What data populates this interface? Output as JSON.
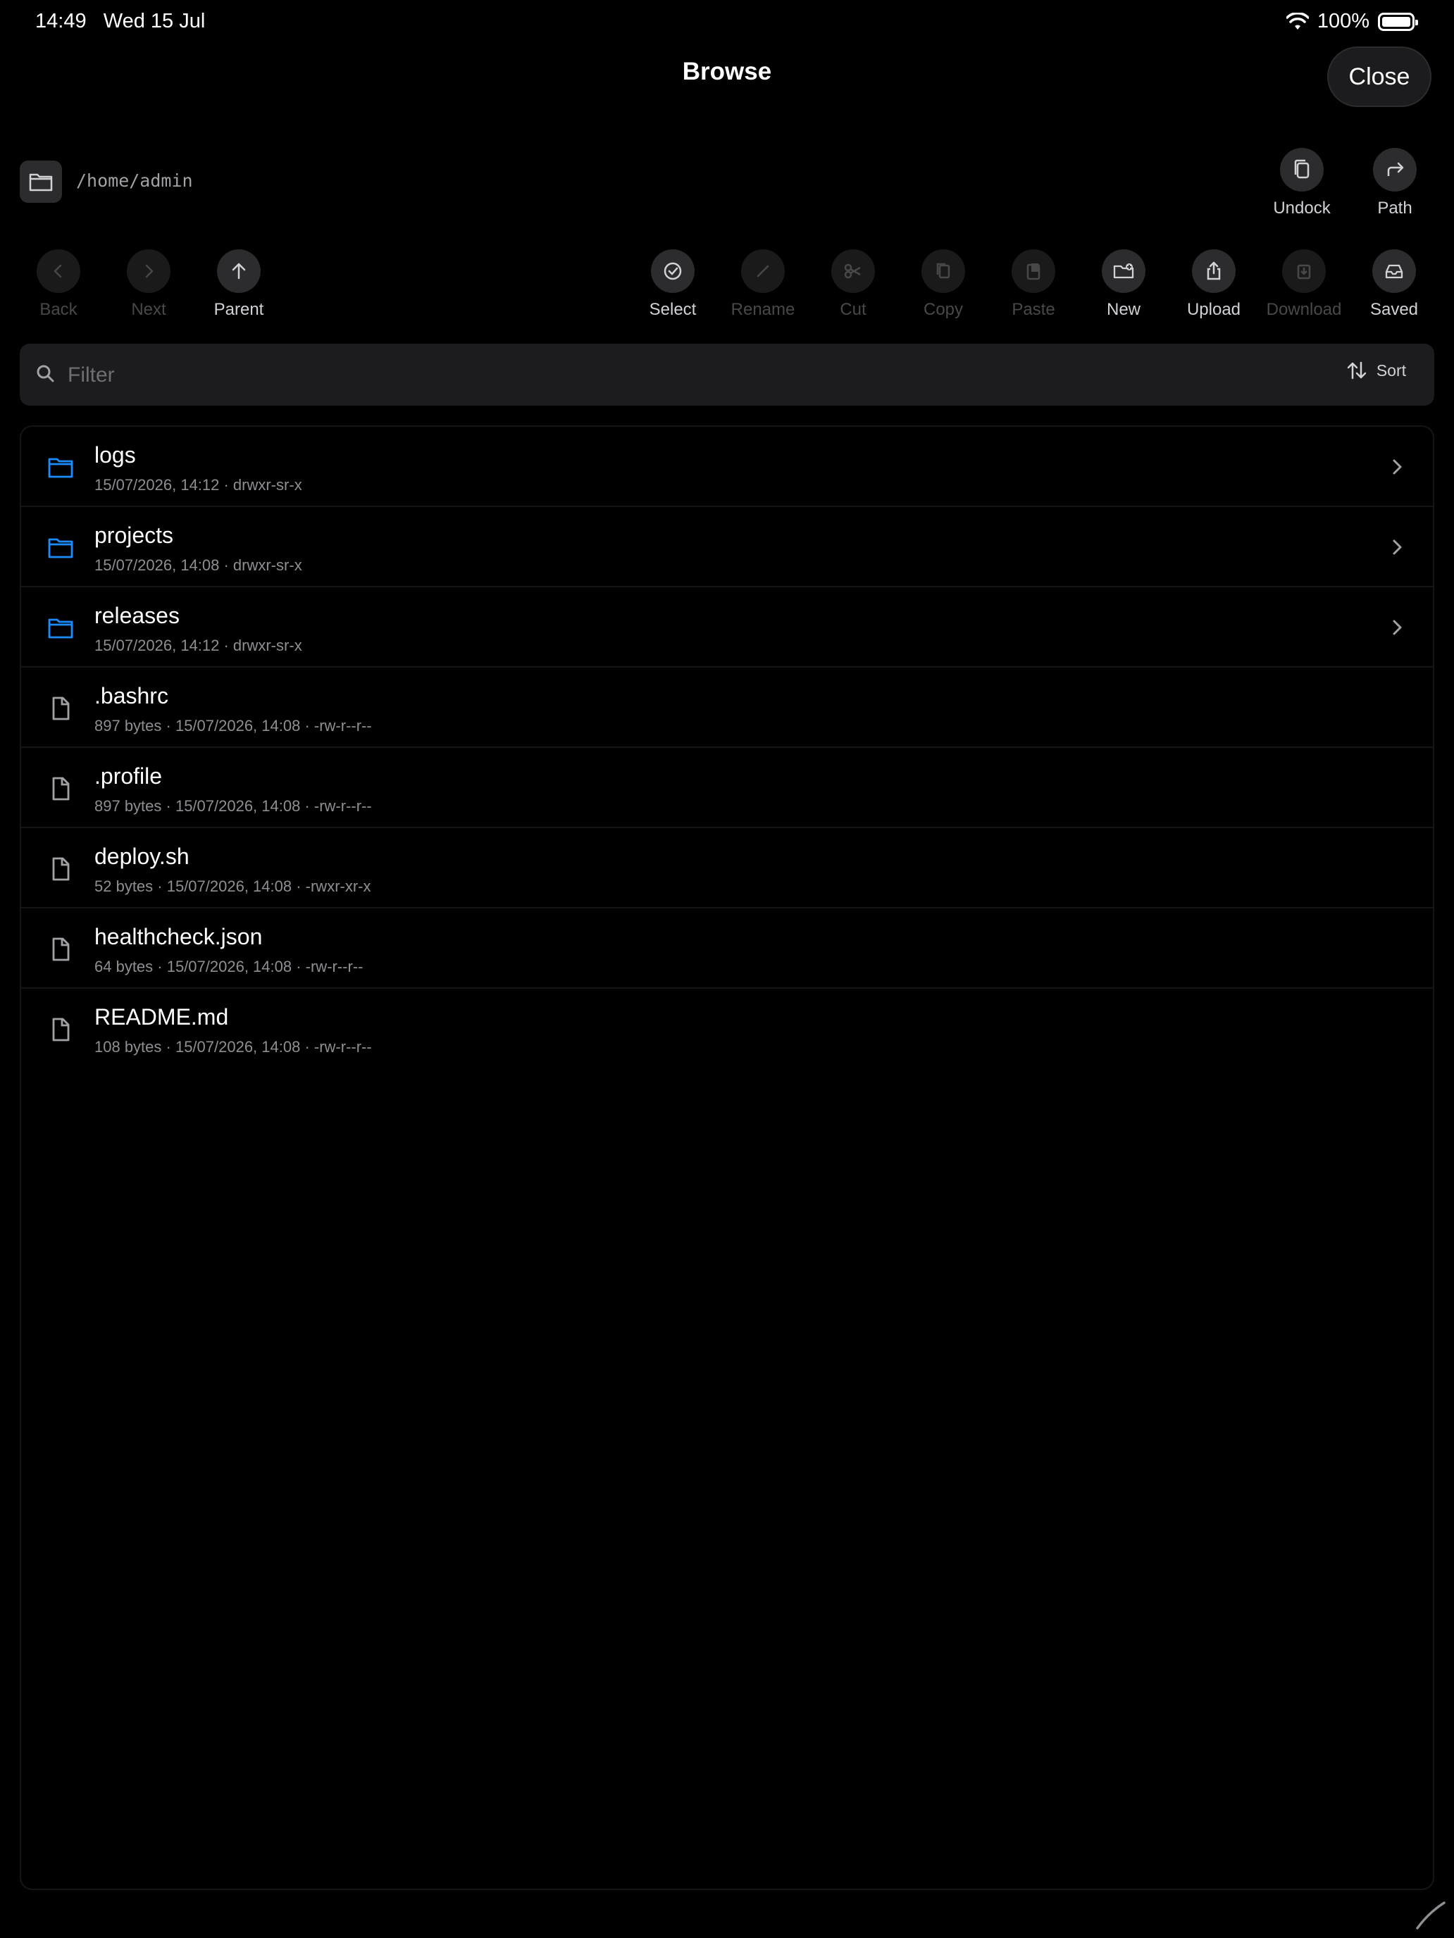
{
  "status": {
    "time": "14:49",
    "date": "Wed 15 Jul",
    "battery": "100%"
  },
  "header": {
    "title": "Browse",
    "close_label": "Close"
  },
  "path": {
    "value": "/home/admin"
  },
  "top_actions": [
    {
      "label": "Undock",
      "icon": "copy-icon"
    },
    {
      "label": "Path",
      "icon": "share-arrow-icon"
    }
  ],
  "toolbar": [
    {
      "label": "Back",
      "enabled": false,
      "icon": "chevron-left-icon"
    },
    {
      "label": "Next",
      "enabled": false,
      "icon": "chevron-right-icon"
    },
    {
      "label": "Parent",
      "enabled": true,
      "icon": "arrow-up-icon"
    },
    {
      "label": "Select",
      "enabled": true,
      "icon": "checkmark-circle-icon"
    },
    {
      "label": "Rename",
      "enabled": false,
      "icon": "pencil-icon"
    },
    {
      "label": "Cut",
      "enabled": false,
      "icon": "scissors-icon"
    },
    {
      "label": "Copy",
      "enabled": false,
      "icon": "doc-copy-icon"
    },
    {
      "label": "Paste",
      "enabled": false,
      "icon": "clipboard-icon"
    },
    {
      "label": "New",
      "enabled": true,
      "icon": "new-folder-icon"
    },
    {
      "label": "Upload",
      "enabled": true,
      "icon": "upload-icon"
    },
    {
      "label": "Download",
      "enabled": false,
      "icon": "download-icon"
    },
    {
      "label": "Saved",
      "enabled": true,
      "icon": "tray-icon"
    }
  ],
  "filter": {
    "placeholder": "Filter",
    "sort_label": "Sort"
  },
  "files": [
    {
      "name": "logs",
      "meta": "15/07/2026, 14:12 · drwxr-sr-x",
      "type": "folder"
    },
    {
      "name": "projects",
      "meta": "15/07/2026, 14:08 · drwxr-sr-x",
      "type": "folder"
    },
    {
      "name": "releases",
      "meta": "15/07/2026, 14:12 · drwxr-sr-x",
      "type": "folder"
    },
    {
      "name": ".bashrc",
      "meta": "897 bytes · 15/07/2026, 14:08 · -rw-r--r--",
      "type": "file"
    },
    {
      "name": ".profile",
      "meta": "897 bytes · 15/07/2026, 14:08 · -rw-r--r--",
      "type": "file"
    },
    {
      "name": "deploy.sh",
      "meta": "52 bytes · 15/07/2026, 14:08 · -rwxr-xr-x",
      "type": "file"
    },
    {
      "name": "healthcheck.json",
      "meta": "64 bytes · 15/07/2026, 14:08 · -rw-r--r--",
      "type": "file"
    },
    {
      "name": "README.md",
      "meta": "108 bytes · 15/07/2026, 14:08 · -rw-r--r--",
      "type": "file"
    }
  ],
  "colors": {
    "folder": "#1a8cff",
    "background": "#000000",
    "surface": "#1c1c1e"
  }
}
